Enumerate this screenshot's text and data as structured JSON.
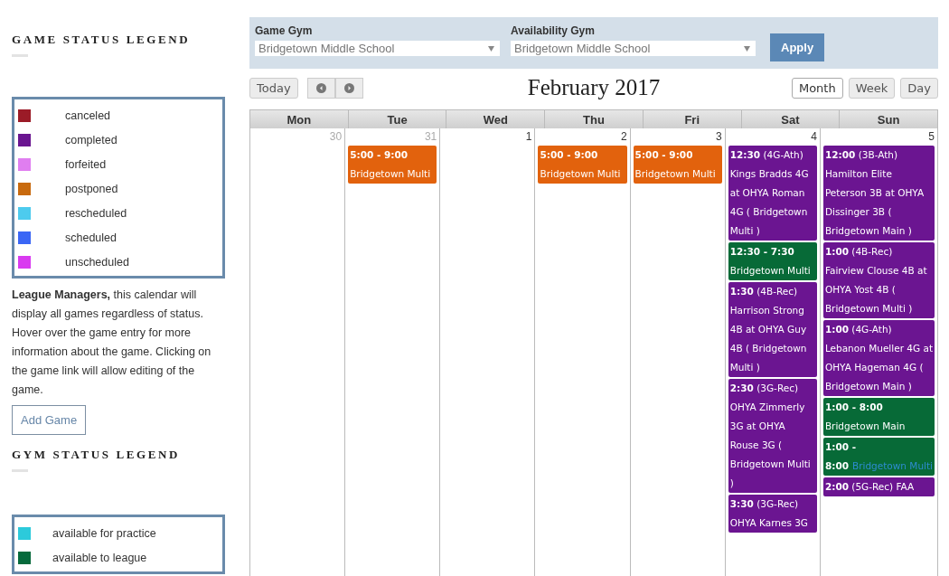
{
  "sidebar": {
    "game_legend": {
      "title": "GAME STATUS LEGEND",
      "items": [
        {
          "label": "canceled",
          "color": "#9b1b27"
        },
        {
          "label": "completed",
          "color": "#6a1590"
        },
        {
          "label": "forfeited",
          "color": "#e07ef0"
        },
        {
          "label": "postponed",
          "color": "#c86a0e"
        },
        {
          "label": "rescheduled",
          "color": "#4dcbee"
        },
        {
          "label": "scheduled",
          "color": "#3a66f5"
        },
        {
          "label": "unscheduled",
          "color": "#d93af0"
        }
      ]
    },
    "note": "**League Managers,** this calendar will display all games regardless of status. Hover over the game entry for more information about the game. Clicking on the game link will allow editing of the game.",
    "add_button": "Add Game",
    "gym_legend": {
      "title": "GYM STATUS LEGEND",
      "items": [
        {
          "label": "available for practice",
          "color": "#2ccadb"
        },
        {
          "label": "available to league",
          "color": "#066a3c"
        }
      ]
    }
  },
  "filters": {
    "game_gym": {
      "label": "Game Gym",
      "value": "Bridgetown Middle School"
    },
    "availability_gym": {
      "label": "Availability Gym",
      "value": "Bridgetown Middle School"
    },
    "apply": "Apply"
  },
  "toolbar": {
    "today": "Today",
    "title": "February 2017",
    "views": [
      {
        "label": "Month",
        "selected": true
      },
      {
        "label": "Week",
        "selected": false
      },
      {
        "label": "Day",
        "selected": false
      }
    ]
  },
  "calendar": {
    "days": [
      "Mon",
      "Tue",
      "Wed",
      "Thu",
      "Fri",
      "Sat",
      "Sun"
    ],
    "cells": [
      {
        "date": "30",
        "other_month": true
      },
      {
        "date": "31",
        "other_month": true,
        "events": [
          {
            "text": "**5:00 - 9:00** Bridgetown Multi",
            "color": "#e2620d"
          }
        ]
      },
      {
        "date": "1",
        "other_month": false
      },
      {
        "date": "2",
        "other_month": false,
        "events": [
          {
            "text": "**5:00 - 9:00** Bridgetown Multi",
            "color": "#e2620d"
          }
        ]
      },
      {
        "date": "3",
        "other_month": false,
        "events": [
          {
            "text": "**5:00 - 9:00** Bridgetown Multi",
            "color": "#e2620d"
          }
        ]
      },
      {
        "date": "4",
        "other_month": false,
        "events": [
          {
            "text": "**12:30** (4G-Ath) Kings Bradds 4G at OHYA Roman 4G ( Bridgetown Multi )",
            "color": "#6b1591"
          },
          {
            "text": "**12:30 - 7:30** Bridgetown Multi",
            "color": "#076a37"
          },
          {
            "text": "**1:30** (4B-Rec) Harrison Strong 4B at OHYA Guy 4B ( Bridgetown Multi )",
            "color": "#6b1591"
          },
          {
            "text": "**2:30** (3G-Rec) OHYA Zimmerly 3G at OHYA Rouse 3G ( Bridgetown Multi )",
            "color": "#6b1591"
          },
          {
            "text": "**3:30** (3G-Rec) OHYA Karnes 3G",
            "color": "#6b1591"
          }
        ]
      },
      {
        "date": "5",
        "other_month": false,
        "events": [
          {
            "text": "**12:00** (3B-Ath) Hamilton Elite Peterson 3B at OHYA Dissinger 3B ( Bridgetown Main )",
            "color": "#6b1591"
          },
          {
            "text": "**1:00** (4B-Rec) Fairview Clouse 4B at OHYA Yost 4B ( Bridgetown Multi )",
            "color": "#6b1591"
          },
          {
            "text": "**1:00** (4G-Ath) Lebanon Mueller 4G at OHYA Hageman 4G ( Bridgetown Main )",
            "color": "#6b1591"
          },
          {
            "text": "**1:00 - 8:00** Bridgetown Main",
            "color": "#076a37"
          },
          {
            "text": "**1:00 - 8:00**",
            "link": "Bridgetown Multi",
            "color": "#076a37"
          },
          {
            "text": "**2:00** (5G-Rec) FAA",
            "color": "#6b1591"
          }
        ]
      }
    ]
  }
}
